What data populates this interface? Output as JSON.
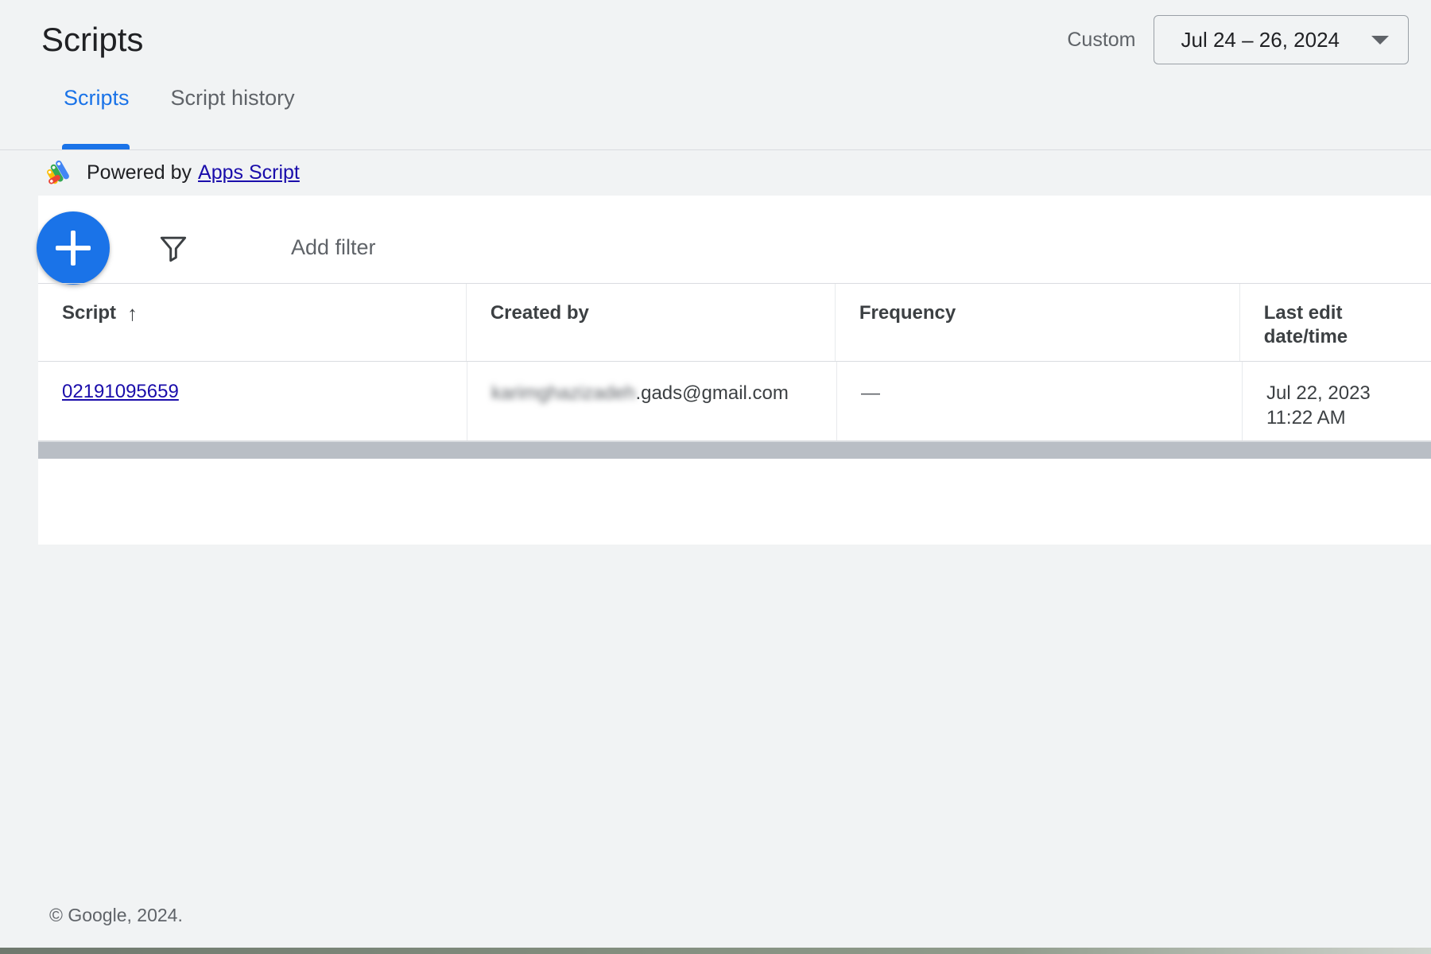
{
  "header": {
    "title": "Scripts",
    "date_label": "Custom",
    "date_value": "Jul 24 – 26, 2024",
    "caret_icon": "chevron-down-icon"
  },
  "tabs": [
    {
      "label": "Scripts",
      "active": true
    },
    {
      "label": "Script history",
      "active": false
    }
  ],
  "powered": {
    "icon": "apps-script-icon",
    "text": "Powered by",
    "link": "Apps Script"
  },
  "toolbar": {
    "create_icon": "plus-icon",
    "filter_icon": "funnel-icon",
    "add_filter_label": "Add filter"
  },
  "table": {
    "columns": [
      {
        "label": "Script",
        "sort_icon": "arrow-up-icon"
      },
      {
        "label": "Created by"
      },
      {
        "label": "Frequency"
      },
      {
        "label": "Last edit date/time"
      }
    ],
    "rows": [
      {
        "script": "02191095659",
        "created_by_blurred": "karimghazizadeh",
        "created_by_visible": ".gads@gmail.com",
        "frequency": "—",
        "last_edit_date": "Jul 22, 2023",
        "last_edit_time": "11:22 AM"
      }
    ]
  },
  "footer": {
    "text": "© Google, 2024."
  },
  "colors": {
    "accent": "#1a73e8",
    "link": "#1a0dab",
    "page_bg": "#f1f3f4",
    "card_bg": "#ffffff",
    "border": "#dadce0",
    "text_primary": "#202124",
    "text_secondary": "#5f6368",
    "scrollbar": "#b9bec5"
  }
}
